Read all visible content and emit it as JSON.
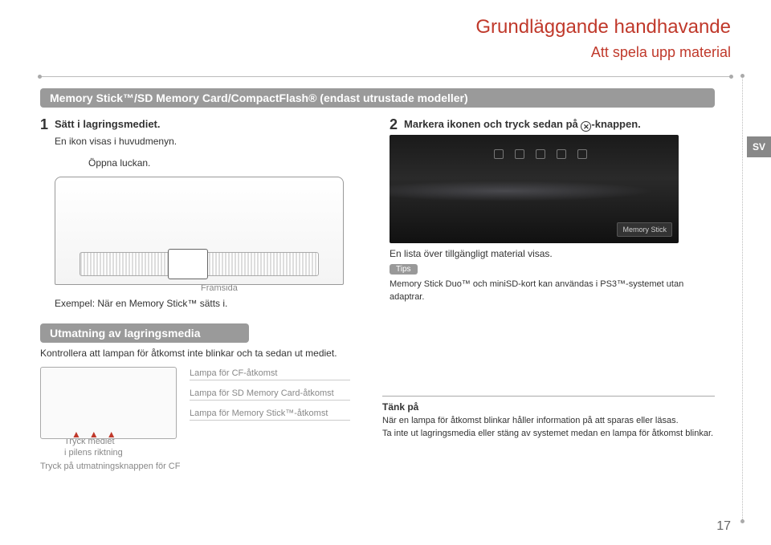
{
  "header": {
    "title1": "Grundläggande handhavande",
    "title2": "Att spela upp material"
  },
  "langTab": "SV",
  "sectionBar": "Memory Stick™/SD Memory Card/CompactFlash® (endast utrustade modeller)",
  "left": {
    "stepNum": "1",
    "stepTitle": "Sätt i lagringsmediet.",
    "sub1": "En ikon visas i huvudmenyn.",
    "sub2": "Öppna luckan.",
    "framside": "Framsida",
    "caption": "Exempel: När en Memory Stick™ sätts i."
  },
  "right": {
    "stepNum": "2",
    "stepTitle": "Markera ikonen och tryck sedan på ",
    "stepTitleEnd": "-knappen.",
    "memoryStickChip": "Memory Stick",
    "caption": "En lista över tillgängligt material visas.",
    "tipsLabel": "Tips",
    "tipsText": "Memory Stick Duo™ och miniSD-kort kan användas i PS3™-systemet utan adaptrar."
  },
  "section2": "Utmatning av lagringsmedia",
  "bottom": {
    "text": "Kontrollera att lampan för åtkomst inte blinkar och ta sedan ut mediet.",
    "labels": [
      "Lampa för CF-åtkomst",
      "Lampa för SD Memory Card-åtkomst",
      "Lampa för Memory Stick™-åtkomst"
    ],
    "tryck1": "Tryck mediet",
    "tryck2": "i pilens riktning",
    "tryck3": "Tryck på utmatningsknappen för CF"
  },
  "note": {
    "heading": "Tänk på",
    "body1": "När en lampa för åtkomst blinkar håller information på att sparas eller läsas.",
    "body2": "Ta inte ut lagringsmedia eller stäng av systemet medan en lampa för åtkomst blinkar."
  },
  "pageNumber": "17"
}
